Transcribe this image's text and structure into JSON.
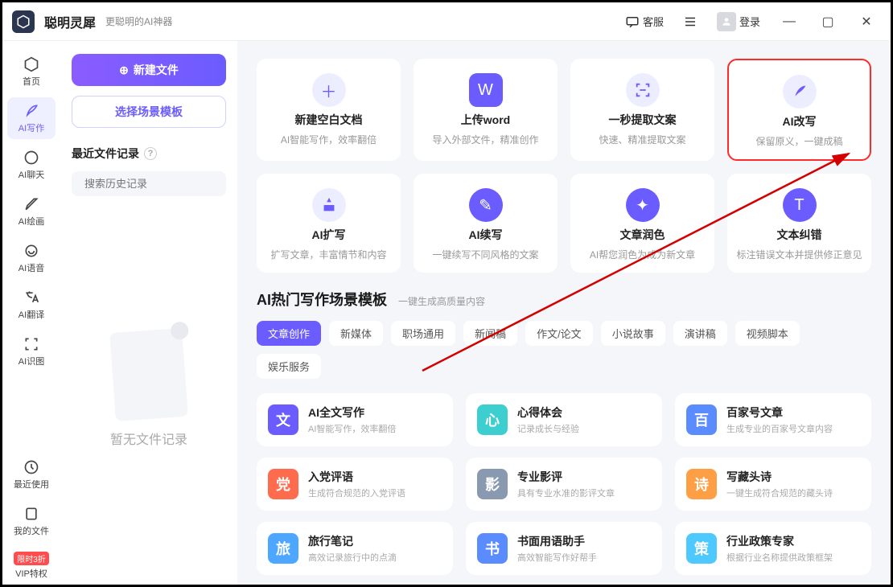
{
  "titlebar": {
    "app_name": "聪明灵犀",
    "app_tagline": "更聪明的AI神器",
    "support_label": "客服",
    "login_label": "登录"
  },
  "sidebar": {
    "items": [
      {
        "label": "首页"
      },
      {
        "label": "AI写作"
      },
      {
        "label": "AI聊天"
      },
      {
        "label": "AI绘画"
      },
      {
        "label": "AI语音"
      },
      {
        "label": "AI翻译"
      },
      {
        "label": "AI识图"
      },
      {
        "label": "最近使用"
      },
      {
        "label": "我的文件"
      },
      {
        "label": "VIP特权"
      }
    ],
    "badge": "限时3折"
  },
  "filepanel": {
    "new_file_label": "新建文件",
    "template_label": "选择场景模板",
    "recent_title": "最近文件记录",
    "search_placeholder": "搜索历史记录",
    "empty_text": "暂无文件记录"
  },
  "feature_cards_row1": [
    {
      "title": "新建空白文档",
      "desc": "AI智能写作，效率翻倍"
    },
    {
      "title": "上传word",
      "desc": "导入外部文件，精准创作"
    },
    {
      "title": "一秒提取文案",
      "desc": "快速、精准提取文案"
    },
    {
      "title": "AI改写",
      "desc": "保留原义，一键成稿"
    }
  ],
  "feature_cards_row2": [
    {
      "title": "AI扩写",
      "desc": "扩写文章，丰富情节和内容"
    },
    {
      "title": "AI续写",
      "desc": "一键续写不同风格的文案"
    },
    {
      "title": "文章润色",
      "desc": "AI帮您润色为成为新文章"
    },
    {
      "title": "文本纠错",
      "desc": "标注错误文本并提供修正意见"
    }
  ],
  "section": {
    "title": "AI热门写作场景模板",
    "subtitle": "一键生成高质量内容"
  },
  "tabs": [
    "文章创作",
    "新媒体",
    "职场通用",
    "新闻稿",
    "作文/论文",
    "小说故事",
    "演讲稿",
    "视频脚本",
    "娱乐服务"
  ],
  "templates": [
    {
      "icon": "文",
      "color": "#6b5cff",
      "title": "AI全文写作",
      "desc": "AI智能写作，效率翻倍"
    },
    {
      "icon": "心",
      "color": "#3dcfcf",
      "title": "心得体会",
      "desc": "记录成长与经验"
    },
    {
      "icon": "百",
      "color": "#5b8cff",
      "title": "百家号文章",
      "desc": "生成专业的百家号文章内容"
    },
    {
      "icon": "党",
      "color": "#ff6b4d",
      "title": "入党评语",
      "desc": "生成符合规范的入党评语"
    },
    {
      "icon": "影",
      "color": "#8899b0",
      "title": "专业影评",
      "desc": "具有专业水准的影评文章"
    },
    {
      "icon": "诗",
      "color": "#ff9f45",
      "title": "写藏头诗",
      "desc": "一键生成符合规范的藏头诗"
    },
    {
      "icon": "旅",
      "color": "#4da6ff",
      "title": "旅行笔记",
      "desc": "高效记录旅行中的点滴"
    },
    {
      "icon": "书",
      "color": "#5b8cff",
      "title": "书面用语助手",
      "desc": "高效智能写作好帮手"
    },
    {
      "icon": "策",
      "color": "#4dc9ff",
      "title": "行业政策专家",
      "desc": "根据行业名称提供政策框架"
    }
  ]
}
